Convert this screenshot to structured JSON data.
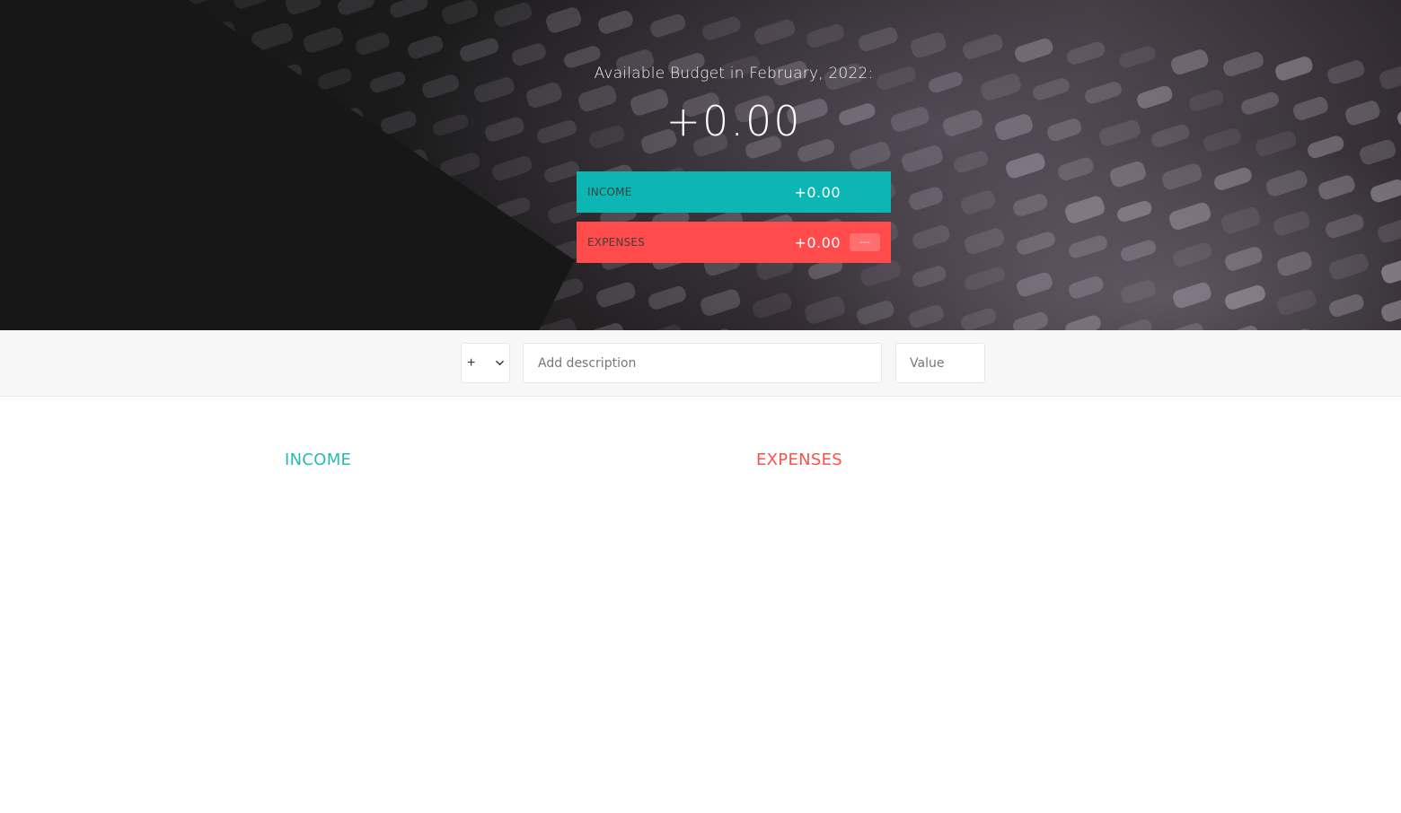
{
  "top": {
    "title": "Available Budget in February, 2022:",
    "budget_value": "+0.00",
    "income": {
      "label": "Income",
      "value": "+0.00",
      "color": "#0cb6b3"
    },
    "expenses": {
      "label": "Expenses",
      "value": "+0.00",
      "percentage": "---",
      "color": "#ff4b4b"
    }
  },
  "add": {
    "type_selected": "+",
    "type_options": [
      "+",
      "-"
    ],
    "description_placeholder": "Add description",
    "description_value": "",
    "value_placeholder": "Value",
    "value_value": ""
  },
  "lists": {
    "income_title": "Income",
    "expenses_title": "Expenses",
    "income_color": "#28b9b5",
    "expenses_color": "#ff5049"
  }
}
